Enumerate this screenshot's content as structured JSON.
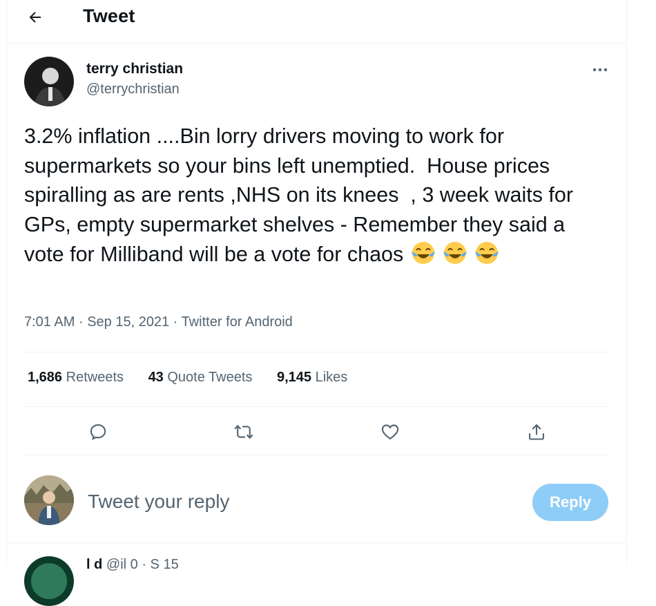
{
  "header": {
    "back_icon": "arrow-left-icon",
    "title": "Tweet"
  },
  "tweet": {
    "author": {
      "display_name": "terry christian",
      "handle": "@terrychristian"
    },
    "more_icon": "more-horizontal-icon",
    "text": "3.2% inflation ....Bin lorry drivers moving to work for supermarkets so your bins left unemptied.  House prices spiralling as are rents ,NHS on its knees  , 3 week waits for GPs, empty supermarket shelves - Remember they said a vote for Milliband will be a vote for chaos ",
    "emojis": [
      "face-with-tears-of-joy",
      "face-with-tears-of-joy",
      "face-with-tears-of-joy"
    ],
    "time": "7:01 AM",
    "date": "Sep 15, 2021",
    "source": "Twitter for Android",
    "separator": "·",
    "stats": {
      "retweets_count": "1,686",
      "retweets_label": "Retweets",
      "quotes_count": "43",
      "quotes_label": "Quote Tweets",
      "likes_count": "9,145",
      "likes_label": "Likes"
    },
    "actions": [
      "reply-icon",
      "retweet-icon",
      "like-icon",
      "share-icon"
    ]
  },
  "reply_box": {
    "placeholder": "Tweet your reply",
    "button_label": "Reply"
  },
  "next_reply": {
    "name_fragment": "l d",
    "handle_fragment": "@il 0  · S  15"
  },
  "colors": {
    "text": "#0f1419",
    "secondary": "#536471",
    "accent": "#1d9bf0",
    "reply_button_disabled": "#8ecdf8",
    "border": "#eff3f4"
  }
}
